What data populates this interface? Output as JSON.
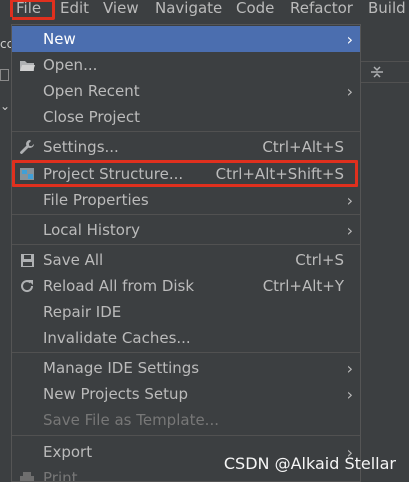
{
  "menubar": {
    "items": [
      "File",
      "Edit",
      "View",
      "Navigate",
      "Code",
      "Refactor",
      "Build"
    ]
  },
  "menu": {
    "items": [
      {
        "label": "New",
        "shortcut": "",
        "arrow": true,
        "selected": true
      },
      {
        "label": "Open...",
        "shortcut": "",
        "arrow": false,
        "icon": "folder-open-icon"
      },
      {
        "label": "Open Recent",
        "shortcut": "",
        "arrow": true
      },
      {
        "label": "Close Project",
        "shortcut": "",
        "arrow": false
      },
      {
        "label": "Settings...",
        "shortcut": "Ctrl+Alt+S",
        "arrow": false,
        "icon": "wrench-icon"
      },
      {
        "label": "Project Structure...",
        "shortcut": "Ctrl+Alt+Shift+S",
        "arrow": false,
        "icon": "project-structure-icon"
      },
      {
        "label": "File Properties",
        "shortcut": "",
        "arrow": true
      },
      {
        "label": "Local History",
        "shortcut": "",
        "arrow": true
      },
      {
        "label": "Save All",
        "shortcut": "Ctrl+S",
        "arrow": false,
        "icon": "save-icon"
      },
      {
        "label": "Reload All from Disk",
        "shortcut": "Ctrl+Alt+Y",
        "arrow": false,
        "icon": "reload-icon"
      },
      {
        "label": "Repair IDE",
        "shortcut": "",
        "arrow": false
      },
      {
        "label": "Invalidate Caches...",
        "shortcut": "",
        "arrow": false
      },
      {
        "label": "Manage IDE Settings",
        "shortcut": "",
        "arrow": true
      },
      {
        "label": "New Projects Setup",
        "shortcut": "",
        "arrow": true
      },
      {
        "label": "Save File as Template...",
        "shortcut": "",
        "arrow": false,
        "disabled": true
      },
      {
        "label": "Export",
        "shortcut": "",
        "arrow": true
      },
      {
        "label": "Print...",
        "shortcut": "",
        "arrow": false,
        "disabled": true,
        "icon": "print-icon"
      }
    ]
  },
  "watermark": "CSDN @Alkaid Stellar",
  "colors": {
    "background": "#3c3f41",
    "selected": "#4b6eaf",
    "highlight_box": "#e0301e",
    "text": "#bbbbbb",
    "disabled_text": "#777777"
  }
}
